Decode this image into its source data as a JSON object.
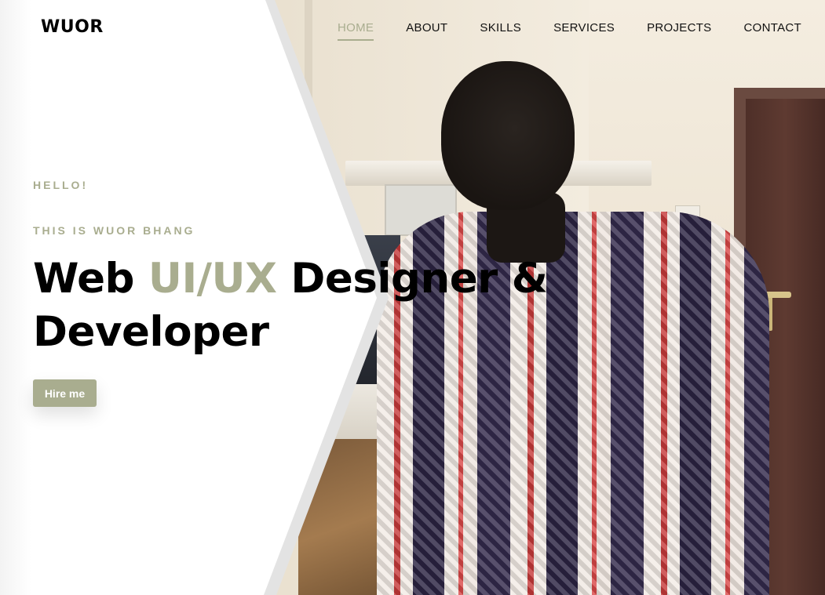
{
  "brand": "WUOR",
  "nav": {
    "items": [
      {
        "label": "HOME",
        "active": true
      },
      {
        "label": "ABOUT",
        "active": false
      },
      {
        "label": "SKILLS",
        "active": false
      },
      {
        "label": "SERVICES",
        "active": false
      },
      {
        "label": "PROJECTS",
        "active": false
      },
      {
        "label": "CONTACT",
        "active": false
      }
    ]
  },
  "hero": {
    "greeting": "HELLO!",
    "subtitle": "THIS IS WUOR BHANG",
    "headline": {
      "part1": "Web ",
      "accent": "UI/UX",
      "part2": " Designer & Developer"
    },
    "cta_label": "Hire me"
  },
  "colors": {
    "accent": "#a9ad8f",
    "text": "#000000",
    "background": "#ffffff"
  }
}
